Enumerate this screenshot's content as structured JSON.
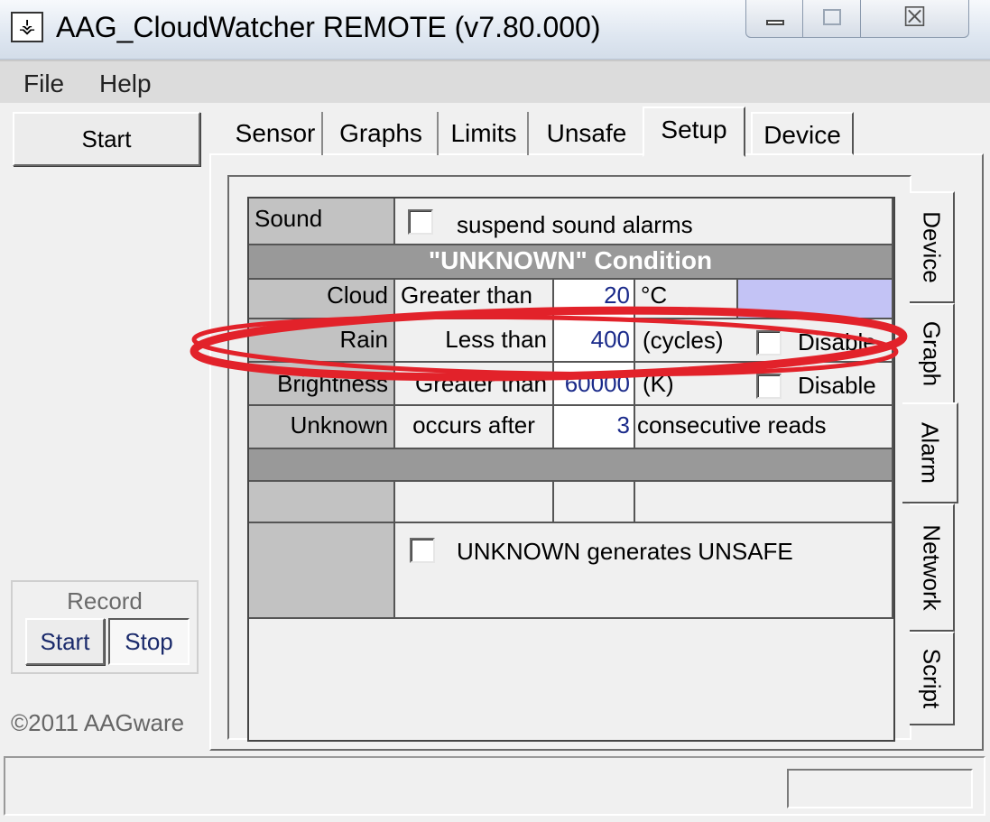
{
  "window": {
    "title": "AAG_CloudWatcher REMOTE (v7.80.000)",
    "icon": "app-icon",
    "buttons": [
      "minimize-icon",
      "maximize-icon",
      "close-icon"
    ],
    "close_glyph": "☒"
  },
  "menu": {
    "file": "File",
    "help": "Help"
  },
  "left": {
    "start": "Start",
    "record": {
      "label": "Record",
      "start": "Start",
      "stop": "Stop"
    },
    "copyright": "©2011 AAGware"
  },
  "tabs": {
    "sensor": "Sensor",
    "graphs": "Graphs",
    "limits": "Limits",
    "unsafe": "Unsafe",
    "setup": "Setup",
    "device": "Device",
    "active": "Setup"
  },
  "side_tabs": {
    "device": "Device",
    "graph": "Graph",
    "alarm": "Alarm",
    "network": "Network",
    "script": "Script",
    "active": "Alarm"
  },
  "grid": {
    "sound_label": "Sound",
    "sound_option": "suspend sound alarms",
    "unknown_header": "\"UNKNOWN\" Condition",
    "cloud": {
      "label": "Cloud",
      "op": "Greater than",
      "value": "20",
      "unit": "°C"
    },
    "rain": {
      "label": "Rain",
      "op": "Less than",
      "value": "400",
      "unit": "(cycles)",
      "disable": "Disable"
    },
    "brightness": {
      "label": "Brightness",
      "op": "Greater than",
      "value": "60000",
      "unit": "(K)",
      "disable": "Disable"
    },
    "unknown": {
      "label": "Unknown",
      "op": "occurs after",
      "value": "3",
      "unit": "consecutive reads"
    },
    "unsafe_option": "UNKNOWN generates UNSAFE"
  },
  "colors": {
    "annotation": "#e2222a",
    "header_bg": "#999999",
    "label_bg": "#c2c2c2",
    "lavender": "#c3c3f5",
    "value_text": "#1a2a8a"
  }
}
